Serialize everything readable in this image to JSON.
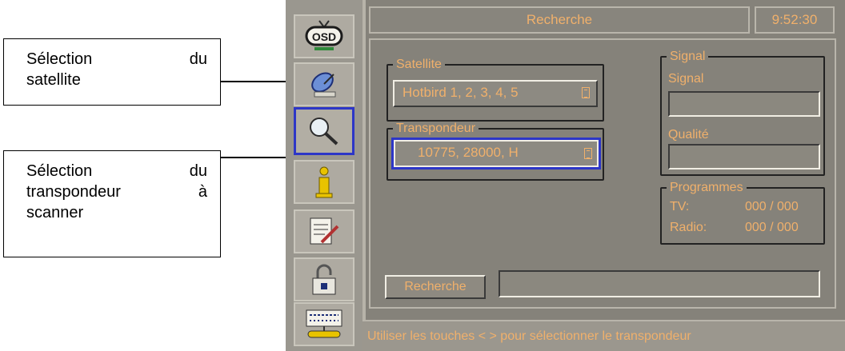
{
  "callouts": [
    {
      "line1_left": "Sélection",
      "line1_right": "du",
      "line2": "satellite"
    },
    {
      "line1_left": "Sélection",
      "line1_right": "du",
      "line2_left": "transpondeur",
      "line2_right": "à",
      "line3": "scanner"
    }
  ],
  "header": {
    "title": "Recherche",
    "clock": "9:52:30"
  },
  "satellite": {
    "legend": "Satellite",
    "value": "Hotbird 1, 2, 3, 4, 5"
  },
  "transponder": {
    "legend": "Transpondeur",
    "value": "10775, 28000, H"
  },
  "signal": {
    "legend": "Signal",
    "signal_label": "Signal",
    "quality_label": "Qualité"
  },
  "programmes": {
    "legend": "Programmes",
    "tv_label": "TV:",
    "tv_value": "000 / 000",
    "radio_label": "Radio:",
    "radio_value": "000 / 000"
  },
  "search_button": {
    "label": "Recherche"
  },
  "status": {
    "text": "Utiliser les touches < > pour sélectionner le transpondeur"
  },
  "sidebar": {
    "osd_label": "OSD",
    "active_index": 2
  },
  "colors": {
    "accent_text": "#f0b06b",
    "selection": "#2d36c7",
    "osd_background": "#85827a"
  }
}
